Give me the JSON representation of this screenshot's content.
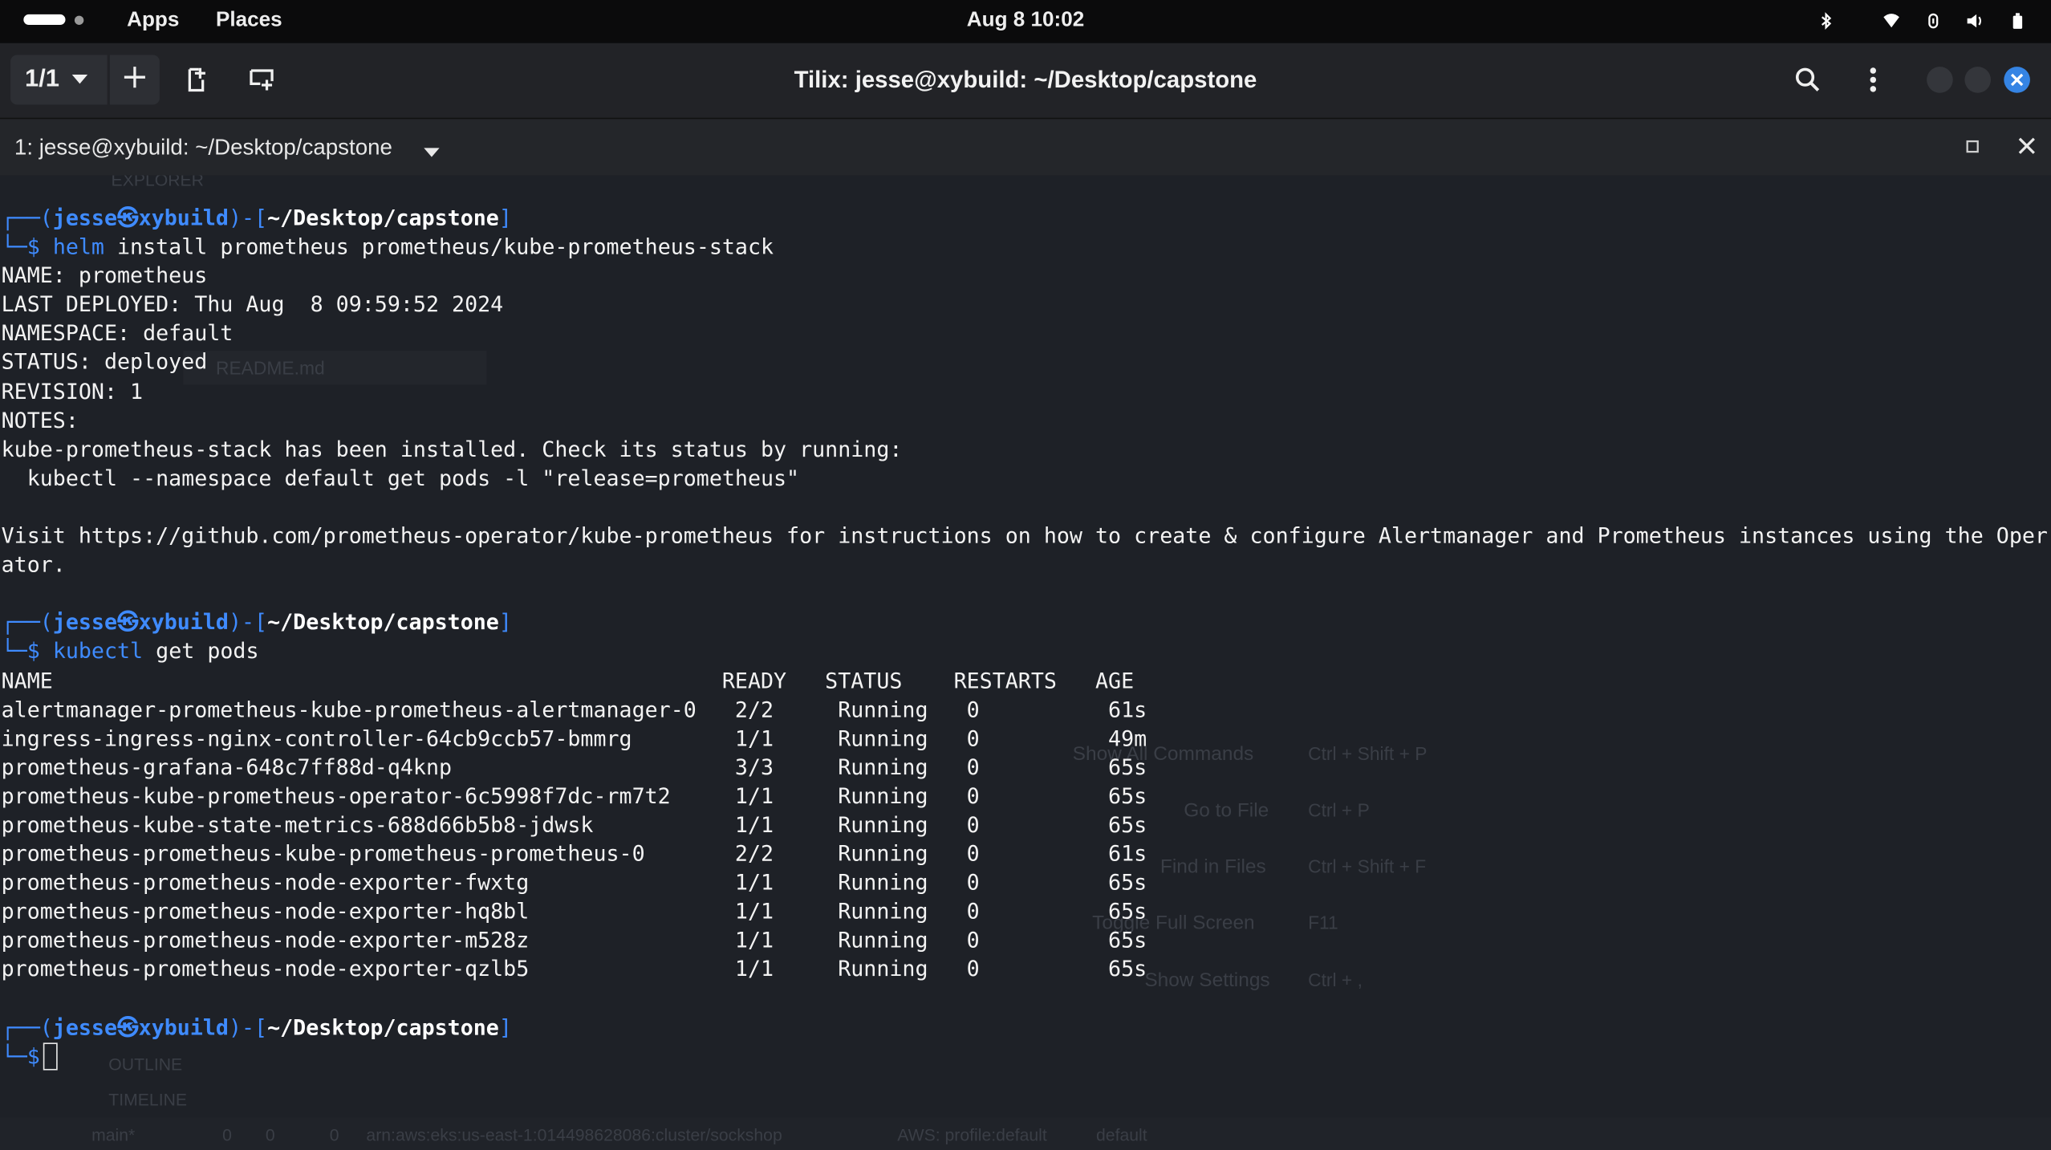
{
  "topbar": {
    "apps_label": "Apps",
    "places_label": "Places",
    "clock": "Aug 8  10:02"
  },
  "header": {
    "session_switch_label": "1/1",
    "window_title": "Tilix: jesse@xybuild: ~/Desktop/capstone"
  },
  "terminal_tab": {
    "title": "1: jesse@xybuild: ~/Desktop/capstone"
  },
  "prompt": {
    "user": "jesse",
    "host": "xybuild",
    "cwd": "~/Desktop/capstone",
    "symbol": "$"
  },
  "commands": {
    "helm_bin": "helm",
    "helm_args": "install prometheus prometheus/kube-prometheus-stack",
    "kubectl_bin": "kubectl",
    "kubectl_args": "get pods"
  },
  "helm_output": [
    "NAME: prometheus",
    "LAST DEPLOYED: Thu Aug  8 09:59:52 2024",
    "NAMESPACE: default",
    "STATUS: deployed",
    "REVISION: 1",
    "NOTES:",
    "kube-prometheus-stack has been installed. Check its status by running:",
    "  kubectl --namespace default get pods -l \"release=prometheus\"",
    "",
    "Visit https://github.com/prometheus-operator/kube-prometheus for instructions on how to create & configure Alertmanager and Prometheus instances using the Oper",
    "ator.",
    ""
  ],
  "pods_table": {
    "header": "NAME                                                    READY   STATUS    RESTARTS   AGE",
    "rows": [
      "alertmanager-prometheus-kube-prometheus-alertmanager-0   2/2     Running   0          61s",
      "ingress-ingress-nginx-controller-64cb9ccb57-bmmrg        1/1     Running   0          49m",
      "prometheus-grafana-648c7ff88d-q4knp                      3/3     Running   0          65s",
      "prometheus-kube-prometheus-operator-6c5998f7dc-rm7t2     1/1     Running   0          65s",
      "prometheus-kube-state-metrics-688d66b5b8-jdwsk           1/1     Running   0          65s",
      "prometheus-prometheus-kube-prometheus-prometheus-0       2/2     Running   0          61s",
      "prometheus-prometheus-node-exporter-fwxtg                1/1     Running   0          65s",
      "prometheus-prometheus-node-exporter-hq8bl                1/1     Running   0          65s",
      "prometheus-prometheus-node-exporter-m528z                1/1     Running   0          65s",
      "prometheus-prometheus-node-exporter-qzlb5                1/1     Running   0          65s"
    ]
  },
  "background_ghost": {
    "explorer": "EXPLORER",
    "readme": "README.md",
    "cmd_show_all": "Show All Commands",
    "cmd_show_all_keys": "Ctrl + Shift + P",
    "cmd_goto_file": "Go to File",
    "cmd_goto_file_keys": "Ctrl + P",
    "cmd_find": "Find in Files",
    "cmd_find_keys": "Ctrl + Shift + F",
    "cmd_fullscreen": "Toggle Full Screen",
    "cmd_fullscreen_keys": "F11",
    "cmd_settings": "Show Settings",
    "cmd_settings_keys": "Ctrl + ,",
    "outline": "OUTLINE",
    "timeline": "TIMELINE",
    "status_branch": "main*",
    "status_errors": "0",
    "status_warnings": "0",
    "status_ports": "0",
    "status_arn": "arn:aws:eks:us-east-1:014498628086:cluster/sockshop",
    "status_aws": "AWS: profile:default",
    "status_default": "default"
  },
  "colors": {
    "prompt_blue": "#3f8bff",
    "terminal_bg": "#1e2127",
    "accent_close": "#3584e4"
  }
}
